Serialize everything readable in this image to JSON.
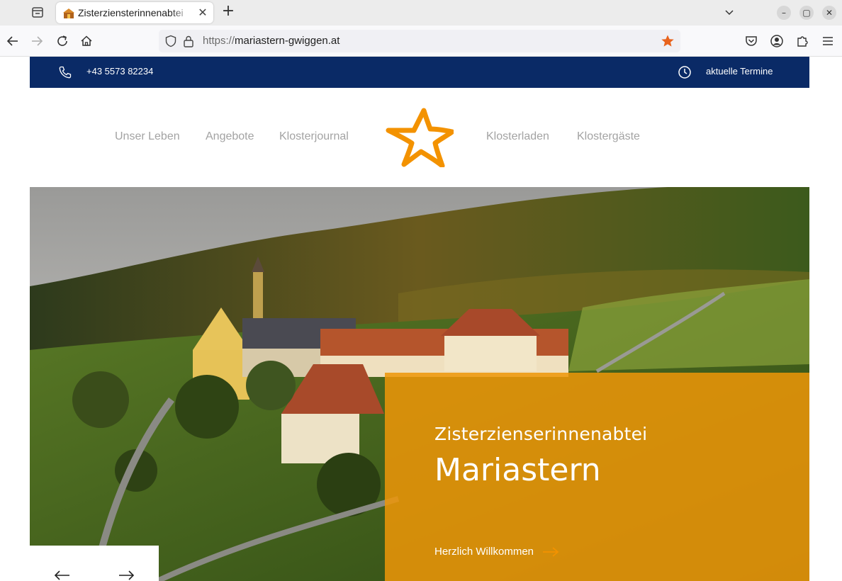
{
  "browser": {
    "tab_title": "Zisterziensterinnenabtei",
    "url_protocol": "https://",
    "url_host": "mariastern-gwiggen.at",
    "icons": [
      "tab-list-icon",
      "close-icon",
      "plus-icon",
      "chevron-down-icon",
      "minimize-icon",
      "maximize-icon",
      "window-close-icon",
      "back-arrow-icon",
      "forward-arrow-icon",
      "reload-icon",
      "home-icon",
      "shield-icon",
      "lock-icon",
      "bookmark-star-icon",
      "pocket-icon",
      "account-icon",
      "extensions-icon",
      "menu-icon"
    ],
    "accent_color": "#e8631c"
  },
  "topbar": {
    "phone": "+43 5573 82234",
    "events_link": "aktuelle Termine",
    "background": "#0a2a66"
  },
  "nav": {
    "items": [
      "Unser Leben",
      "Angebote",
      "Klosterjournal",
      "Klosterladen",
      "Klostergäste"
    ],
    "logo_color": "#f39200"
  },
  "hero": {
    "subtitle": "Zisterzienserinnenabtei",
    "title": "Mariastern",
    "cta": "Herzlich Willkommen",
    "panel_color": "#ee9608"
  },
  "slider": {
    "prev_icon": "arrow-left-icon",
    "next_icon": "arrow-right-icon"
  }
}
